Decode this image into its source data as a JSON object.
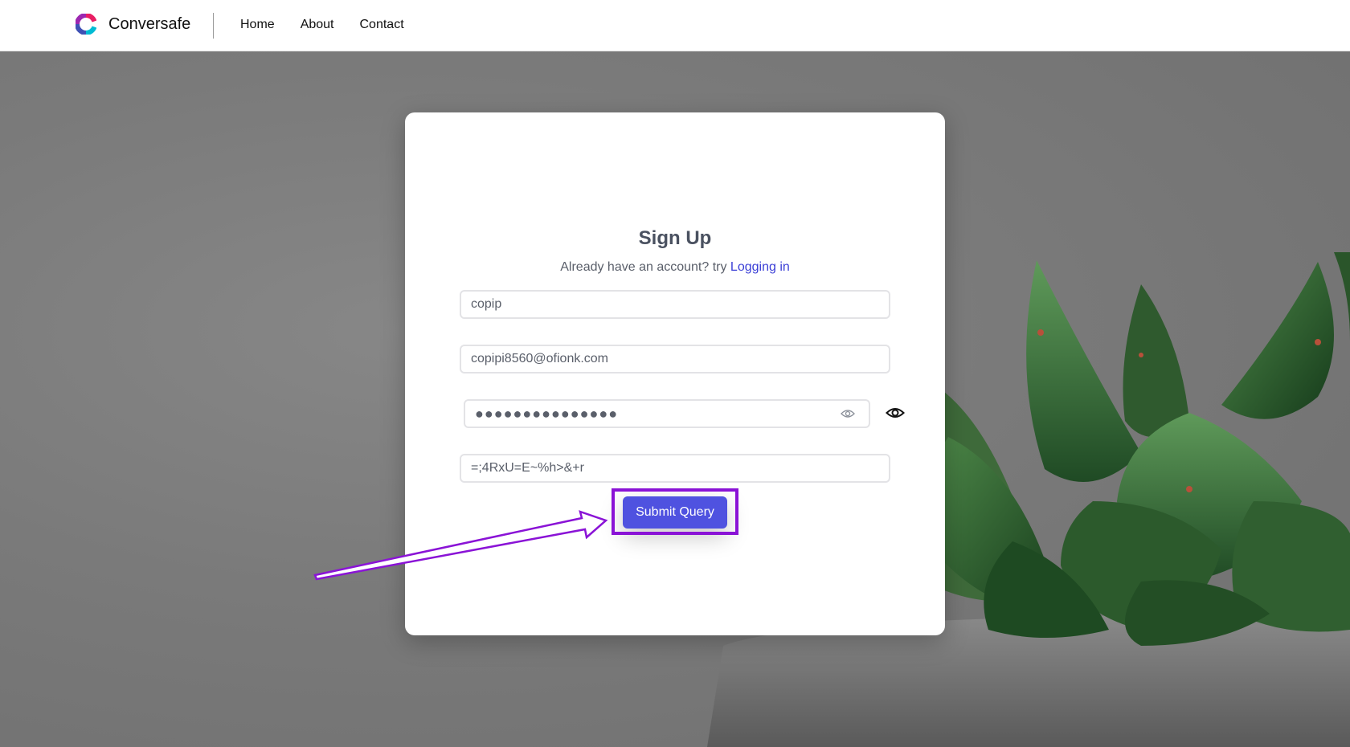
{
  "navbar": {
    "brand_name": "Conversafe",
    "links": [
      "Home",
      "About",
      "Contact"
    ]
  },
  "signup": {
    "title": "Sign Up",
    "subtitle_prefix": "Already have an account? try ",
    "login_link": "Logging in",
    "username_value": "copip",
    "email_value": "copipi8560@ofionk.com",
    "password_value": "●●●●●●●●●●●●●●●",
    "confirm_value": "=;4RxU=E~%h>&+r",
    "submit_label": "Submit Query"
  },
  "colors": {
    "accent": "#4f52e0",
    "link": "#3b3fd6",
    "annotation": "#8a13d6"
  }
}
